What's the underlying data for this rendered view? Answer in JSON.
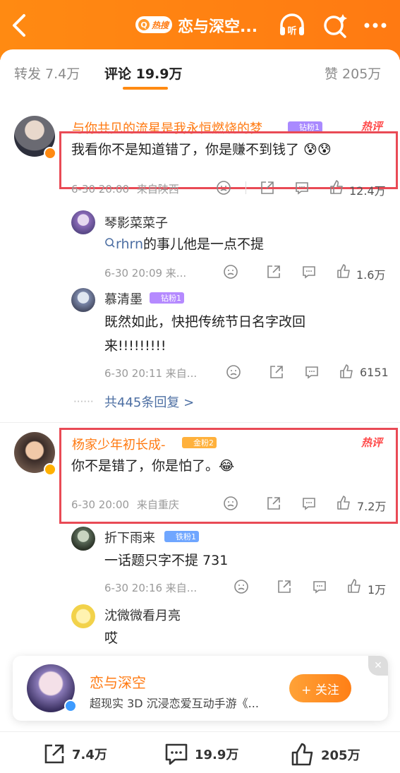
{
  "header": {
    "hot_badge": "热搜",
    "title": "恋与深空...",
    "listen_label": "听"
  },
  "tabs": [
    {
      "label": "转发 7.4万"
    },
    {
      "label": "评论 19.9万"
    },
    {
      "label": "赞 205万"
    }
  ],
  "comments": [
    {
      "user": "与你共见的流星是我永恒燃烧的梦",
      "fan_badge": "钻粉1",
      "hot_label": "热评",
      "text": "我看你不是知道错了，你是赚不到钱了 😰😰",
      "time": "6-30 20:00",
      "location": "来自陕西",
      "likes": "12.4万",
      "replies": [
        {
          "user": "琴影菜菜子",
          "text_prefix": "rhrn",
          "text": "的事儿他是一点不提",
          "time": "6-30 20:09 来...",
          "likes": "1.6万"
        },
        {
          "user": "慕清墨",
          "fan_badge": "钻粉1",
          "text_line1": "既然如此，快把传统节日名字改回",
          "text_line2": "来!!!!!!!!!",
          "time": "6-30 20:11 来自...",
          "likes": "6151"
        }
      ],
      "reply_all": "共445条回复 >"
    },
    {
      "user": "杨家少年初长成-",
      "fan_badge": "金粉2",
      "hot_label": "热评",
      "text": "你不是错了，你是怕了。😂",
      "time": "6-30 20:00",
      "location": "来自重庆",
      "likes": "7.2万",
      "replies": [
        {
          "user": "折下雨来",
          "fan_badge": "铁粉1",
          "text": "一话题只字不提 731",
          "time": "6-30 20:16 来自...",
          "likes": "1万"
        },
        {
          "user": "沈微微看月亮",
          "text": "哎"
        }
      ]
    }
  ],
  "promo": {
    "name": "恋与深空",
    "description": "超现实 3D 沉浸恋爱互动手游《...",
    "follow_label": "+ 关注"
  },
  "bottom_bar": {
    "repost_count": "7.4万",
    "comment_count": "19.9万",
    "like_count": "205万"
  },
  "colors": {
    "brand_orange": "#ff7a12",
    "highlight_red": "#e94a55",
    "link_blue": "#4d6fa3"
  }
}
